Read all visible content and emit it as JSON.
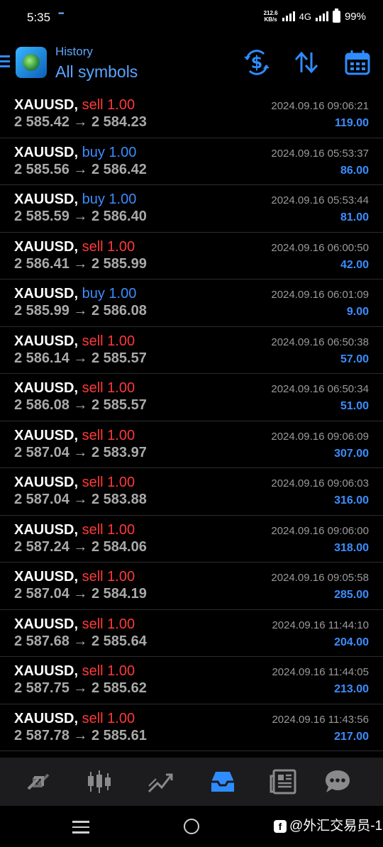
{
  "status": {
    "time": "5:35",
    "speed_value": "212.6",
    "speed_unit": "KB/s",
    "network": "4G",
    "battery": "99%"
  },
  "header": {
    "subtitle": "History",
    "title": "All symbols"
  },
  "trades": [
    {
      "symbol": "XAUUSD,",
      "side": "sell",
      "volume": "1.00",
      "open": "2 585.42",
      "close": "2 584.23",
      "date": "2024.09.16 09:06:21",
      "profit": "119.00"
    },
    {
      "symbol": "XAUUSD,",
      "side": "buy",
      "volume": "1.00",
      "open": "2 585.56",
      "close": "2 586.42",
      "date": "2024.09.16 05:53:37",
      "profit": "86.00"
    },
    {
      "symbol": "XAUUSD,",
      "side": "buy",
      "volume": "1.00",
      "open": "2 585.59",
      "close": "2 586.40",
      "date": "2024.09.16 05:53:44",
      "profit": "81.00"
    },
    {
      "symbol": "XAUUSD,",
      "side": "sell",
      "volume": "1.00",
      "open": "2 586.41",
      "close": "2 585.99",
      "date": "2024.09.16 06:00:50",
      "profit": "42.00"
    },
    {
      "symbol": "XAUUSD,",
      "side": "buy",
      "volume": "1.00",
      "open": "2 585.99",
      "close": "2 586.08",
      "date": "2024.09.16 06:01:09",
      "profit": "9.00"
    },
    {
      "symbol": "XAUUSD,",
      "side": "sell",
      "volume": "1.00",
      "open": "2 586.14",
      "close": "2 585.57",
      "date": "2024.09.16 06:50:38",
      "profit": "57.00"
    },
    {
      "symbol": "XAUUSD,",
      "side": "sell",
      "volume": "1.00",
      "open": "2 586.08",
      "close": "2 585.57",
      "date": "2024.09.16 06:50:34",
      "profit": "51.00"
    },
    {
      "symbol": "XAUUSD,",
      "side": "sell",
      "volume": "1.00",
      "open": "2 587.04",
      "close": "2 583.97",
      "date": "2024.09.16 09:06:09",
      "profit": "307.00"
    },
    {
      "symbol": "XAUUSD,",
      "side": "sell",
      "volume": "1.00",
      "open": "2 587.04",
      "close": "2 583.88",
      "date": "2024.09.16 09:06:03",
      "profit": "316.00"
    },
    {
      "symbol": "XAUUSD,",
      "side": "sell",
      "volume": "1.00",
      "open": "2 587.24",
      "close": "2 584.06",
      "date": "2024.09.16 09:06:00",
      "profit": "318.00"
    },
    {
      "symbol": "XAUUSD,",
      "side": "sell",
      "volume": "1.00",
      "open": "2 587.04",
      "close": "2 584.19",
      "date": "2024.09.16 09:05:58",
      "profit": "285.00"
    },
    {
      "symbol": "XAUUSD,",
      "side": "sell",
      "volume": "1.00",
      "open": "2 587.68",
      "close": "2 585.64",
      "date": "2024.09.16 11:44:10",
      "profit": "204.00"
    },
    {
      "symbol": "XAUUSD,",
      "side": "sell",
      "volume": "1.00",
      "open": "2 587.75",
      "close": "2 585.62",
      "date": "2024.09.16 11:44:05",
      "profit": "213.00"
    },
    {
      "symbol": "XAUUSD,",
      "side": "sell",
      "volume": "1.00",
      "open": "2 587.78",
      "close": "2 585.61",
      "date": "2024.09.16 11:43:56",
      "profit": "217.00"
    }
  ],
  "arrow": "→",
  "toolbar": {
    "items": [
      "quotes-icon",
      "chart-icon",
      "trade-icon",
      "history-icon",
      "news-icon",
      "chat-icon"
    ],
    "active": "history-icon"
  },
  "watermark": {
    "badge": "f",
    "text": "@外汇交易员-1"
  },
  "colors": {
    "accent": "#3c8dff",
    "sell": "#ff3838",
    "buy": "#3c8dff",
    "background": "#000000"
  }
}
